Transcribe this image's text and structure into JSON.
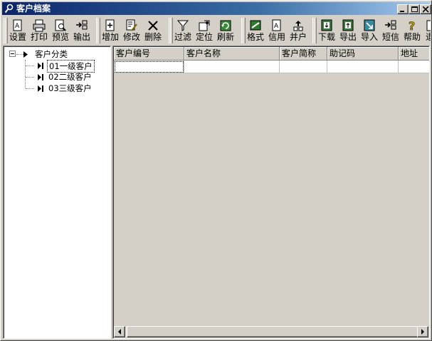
{
  "window": {
    "title": "客户档案",
    "controls": [
      "minimize",
      "maximize",
      "close"
    ]
  },
  "toolbar": {
    "groups": [
      [
        {
          "label": "设置",
          "icon": "settings-icon"
        },
        {
          "label": "打印",
          "icon": "print-icon"
        },
        {
          "label": "预览",
          "icon": "preview-icon"
        },
        {
          "label": "输出",
          "icon": "output-icon"
        }
      ],
      [
        {
          "label": "增加",
          "icon": "add-icon"
        },
        {
          "label": "修改",
          "icon": "edit-icon"
        },
        {
          "label": "删除",
          "icon": "delete-icon"
        }
      ],
      [
        {
          "label": "过滤",
          "icon": "filter-icon"
        },
        {
          "label": "定位",
          "icon": "locate-icon"
        },
        {
          "label": "刷新",
          "icon": "refresh-icon"
        }
      ],
      [
        {
          "label": "格式",
          "icon": "format-icon"
        },
        {
          "label": "信用",
          "icon": "credit-icon"
        },
        {
          "label": "并户",
          "icon": "merge-icon"
        }
      ],
      [
        {
          "label": "下载",
          "icon": "download-icon"
        },
        {
          "label": "导出",
          "icon": "export-icon"
        },
        {
          "label": "导入",
          "icon": "import-icon"
        },
        {
          "label": "短信",
          "icon": "sms-icon"
        },
        {
          "label": "帮助",
          "icon": "help-icon"
        },
        {
          "label": "退",
          "icon": "exit-icon"
        }
      ]
    ]
  },
  "tree": {
    "root": "客户分类",
    "children": [
      "01一级客户",
      "02二级客户",
      "03三级客户"
    ],
    "selected_index": 0
  },
  "grid": {
    "columns": [
      "客户编号",
      "客户名称",
      "客户简称",
      "助记码",
      "地址"
    ],
    "rows": [
      [
        "",
        "",
        "",
        "",
        ""
      ]
    ]
  }
}
